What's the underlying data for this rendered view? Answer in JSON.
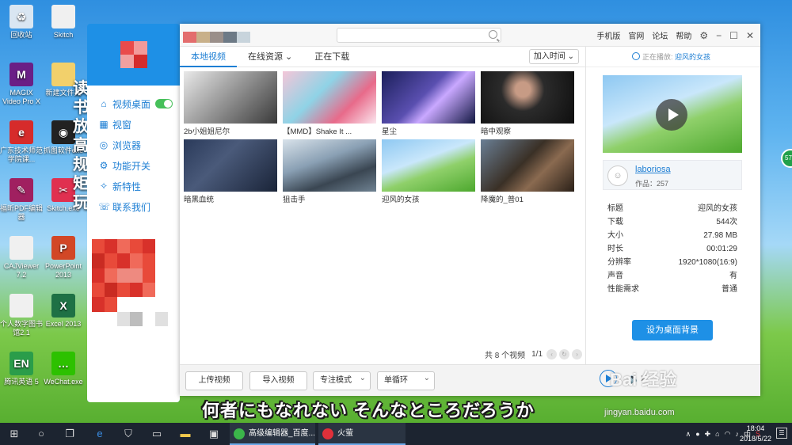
{
  "desktop": {
    "icons": [
      {
        "label": "回收站",
        "glyph": "♻",
        "color": "#d9e6f2"
      },
      {
        "label": "Skitch",
        "glyph": "",
        "color": "#f0f0f0"
      },
      {
        "label": "MAGIX Video Pro X",
        "glyph": "M",
        "color": "#6a1f86"
      },
      {
        "label": "新建文件夹",
        "glyph": "",
        "color": "#f2d06b"
      },
      {
        "label": "广东技术师范学院课...",
        "glyph": "e",
        "color": "#d62b2b"
      },
      {
        "label": "抓图软件exe",
        "glyph": "◉",
        "color": "#222222"
      },
      {
        "label": "福昕PDF编辑器",
        "glyph": "✎",
        "color": "#a02060"
      },
      {
        "label": "Skitch.exe",
        "glyph": "✂",
        "color": "#e03050"
      },
      {
        "label": "CAJViewer 7.2",
        "glyph": "",
        "color": "#f0f0f0"
      },
      {
        "label": "PowerPoint 2013",
        "glyph": "P",
        "color": "#d24726"
      },
      {
        "label": "个人数字图书馆2.1",
        "glyph": "",
        "color": "#f0f0f0"
      },
      {
        "label": "Excel 2013",
        "glyph": "X",
        "color": "#1e7145"
      },
      {
        "label": "腾讯英语 5",
        "glyph": "EN",
        "color": "#2a9d4a"
      },
      {
        "label": "WeChat.exe",
        "glyph": "…",
        "color": "#2dc100"
      }
    ],
    "side_chars": "读书放高规矩玩",
    "subtitle": "何者にもなれない そんなところだろうか",
    "watermark": "Bai 经验",
    "watermark_sub": "jingyan.baidu.com",
    "edge_badge": "57"
  },
  "sidebar": {
    "items": [
      {
        "label": "视频桌面",
        "icon": "home-icon",
        "glyph": "⌂"
      },
      {
        "label": "视窗",
        "icon": "grid-icon",
        "glyph": "▦"
      },
      {
        "label": "浏览器",
        "icon": "browser-icon",
        "glyph": "◎"
      },
      {
        "label": "功能开关",
        "icon": "switch-icon",
        "glyph": "⚙"
      },
      {
        "label": "新特性",
        "icon": "bulb-icon",
        "glyph": "✧"
      },
      {
        "label": "联系我们",
        "icon": "chat-icon",
        "glyph": "☏"
      }
    ],
    "toggle_on": true
  },
  "titlebar": {
    "search_placeholder": "",
    "nav": [
      "手机版",
      "官网",
      "论坛",
      "帮助"
    ],
    "swatch_colors": [
      "#e36d6d",
      "#c8b08a",
      "#9a8f8a",
      "#6d7a86",
      "#c8d4dc"
    ]
  },
  "tabs": [
    {
      "label": "本地视频",
      "active": true
    },
    {
      "label": "在线资源 ⌄",
      "active": false
    },
    {
      "label": "正在下载",
      "active": false
    }
  ],
  "sort_label": "加入时间 ⌄",
  "videos": [
    {
      "title": "2b小姐姐尼尔",
      "bg": "linear-gradient(135deg,#e9e9e9,#9a9a9a 45%,#3a3a3a)"
    },
    {
      "title": "【MMD】Shake It ...",
      "bg": "linear-gradient(135deg,#f4c6d8,#8fd3e6 40%,#e86a8a 70%,#fbe6ee)"
    },
    {
      "title": "星尘",
      "bg": "linear-gradient(135deg,#1b1f5a,#5a4fb0 45%,#c9a8ff 60%,#121842)"
    },
    {
      "title": "暗中观察",
      "bg": "radial-gradient(circle at 45% 35%,#c79b85 12%,#2b2b2b 35%,#0e0e0e)"
    },
    {
      "title": "暗黑血统",
      "bg": "linear-gradient(135deg,#2a3a5a,#4a5a7a 40%,#1a2438)"
    },
    {
      "title": "狙击手",
      "bg": "linear-gradient(160deg,#d8e2ea,#8aa0b4 40%,#3a4652 70%,#6f8292)"
    },
    {
      "title": "迎风的女孩",
      "bg": "linear-gradient(160deg,#8ec8f2,#c9e7fb 40%,#8fd06a 60%,#4da82e)"
    },
    {
      "title": "降魔的_普01",
      "bg": "linear-gradient(135deg,#6a7f95,#3a3026 45%,#8a6a50 65%,#2a2018)"
    }
  ],
  "pager": {
    "total": "共 8 个视频",
    "page": "1/1"
  },
  "bottom_buttons": {
    "upload": "上传视频",
    "import": "导入视频",
    "mode": "专注模式",
    "loop": "单循环"
  },
  "now_playing": {
    "prefix": "正在播放:",
    "title": "迎风的女孩"
  },
  "author": {
    "name": "laboriosa",
    "works": "作品：257"
  },
  "properties": [
    {
      "k": "标题",
      "v": "迎风的女孩"
    },
    {
      "k": "下载",
      "v": "544次"
    },
    {
      "k": "大小",
      "v": "27.98 MB"
    },
    {
      "k": "时长",
      "v": "00:01:29"
    },
    {
      "k": "分辨率",
      "v": "1920*1080(16:9)"
    },
    {
      "k": "声音",
      "v": "有"
    },
    {
      "k": "性能需求",
      "v": "普通"
    }
  ],
  "set_bg_label": "设为桌面背景",
  "taskbar": {
    "apps": [
      {
        "label": "高级编辑器_百度...",
        "color": "#3bb54a"
      },
      {
        "label": "火萤",
        "color": "#e0303a"
      }
    ],
    "tray_lang": "中",
    "time": "18:04",
    "date": "2018/5/22"
  }
}
